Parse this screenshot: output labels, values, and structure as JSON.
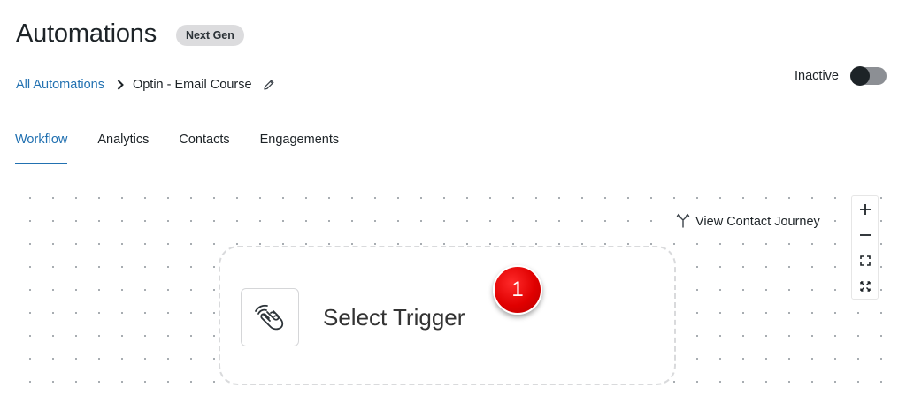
{
  "header": {
    "title": "Automations",
    "badge": "Next Gen"
  },
  "breadcrumb": {
    "parent": "All Automations",
    "current": "Optin - Email Course",
    "separator_icon": "chevron-right-icon",
    "edit_icon": "pencil-icon"
  },
  "status": {
    "label": "Inactive",
    "active": false
  },
  "tabs": [
    {
      "label": "Workflow",
      "active": true
    },
    {
      "label": "Analytics",
      "active": false
    },
    {
      "label": "Contacts",
      "active": false
    },
    {
      "label": "Engagements",
      "active": false
    }
  ],
  "canvas": {
    "journey_link": "View Contact Journey",
    "journey_icon": "branch-icon",
    "zoom_controls": [
      "zoom-in-icon",
      "zoom-out-icon",
      "fit-view-icon",
      "fullscreen-icon"
    ]
  },
  "trigger": {
    "label": "Select Trigger",
    "icon": "hand-tap-icon"
  },
  "step_marker": {
    "number": "1"
  },
  "colors": {
    "accent": "#2271b1",
    "marker": "#e00000",
    "badge_bg": "#dcdcde"
  }
}
